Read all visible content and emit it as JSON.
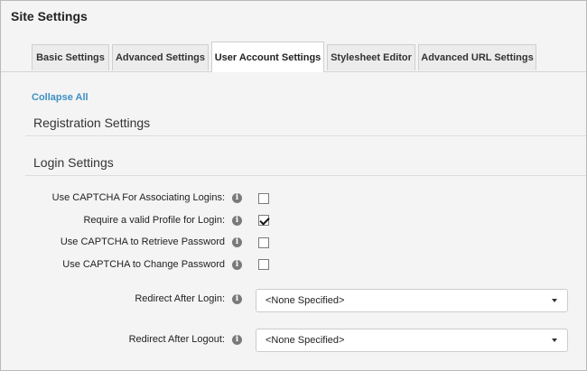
{
  "page": {
    "title": "Site Settings"
  },
  "tabs": [
    {
      "label": "Basic Settings"
    },
    {
      "label": "Advanced Settings"
    },
    {
      "label": "User Account Settings"
    },
    {
      "label": "Stylesheet Editor"
    },
    {
      "label": "Advanced URL Settings"
    }
  ],
  "active_tab": "User Account Settings",
  "collapse_all": "Collapse All",
  "sections": {
    "registration": "Registration Settings",
    "login": "Login Settings"
  },
  "fields": {
    "captcha_associating": {
      "label": "Use CAPTCHA For Associating Logins:",
      "checked": false
    },
    "valid_profile": {
      "label": "Require a valid Profile for Login:",
      "checked": true
    },
    "captcha_retrieve": {
      "label": "Use CAPTCHA to Retrieve Password",
      "checked": false
    },
    "captcha_change": {
      "label": "Use CAPTCHA to Change Password",
      "checked": false
    },
    "redirect_login": {
      "label": "Redirect After Login:",
      "value": "<None Specified>"
    },
    "redirect_logout": {
      "label": "Redirect After Logout:",
      "value": "<None Specified>"
    }
  },
  "icons": {
    "info": "info-icon",
    "dropdown": "chevron-down-icon",
    "check": "check-icon"
  },
  "info_glyph": "i",
  "colors": {
    "link": "#3f8fc4",
    "background": "#f4f4f4",
    "tab_active": "#ffffff"
  }
}
